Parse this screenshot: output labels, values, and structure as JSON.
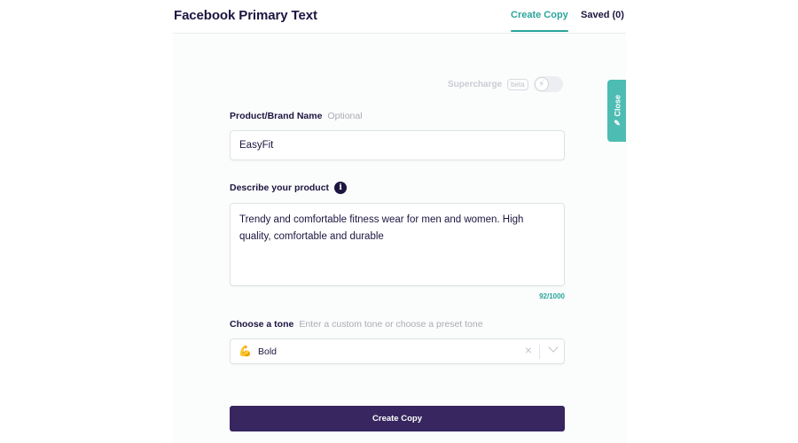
{
  "header": {
    "title": "Facebook Primary Text",
    "tabs": [
      {
        "label": "Create Copy",
        "active": true
      },
      {
        "label": "Saved (0)",
        "active": false
      }
    ]
  },
  "supercharge": {
    "label": "Supercharge",
    "badge": "beta",
    "toggle_on": false,
    "icon": "lightning-icon"
  },
  "close_tab": {
    "label": "Close",
    "icon": "pencil-icon"
  },
  "form": {
    "product_name": {
      "label": "Product/Brand Name",
      "hint": "Optional",
      "value": "EasyFit"
    },
    "description": {
      "label": "Describe your product",
      "info_icon": "i",
      "value": "Trendy and comfortable fitness wear for men and women. High quality, comfortable and durable",
      "char_count": "92/1000"
    },
    "tone": {
      "label": "Choose a tone",
      "hint": "Enter a custom tone or choose a preset tone",
      "selected_emoji": "💪",
      "selected": "Bold",
      "clear_icon": "×"
    },
    "submit_label": "Create Copy"
  },
  "colors": {
    "accent": "#2aa59b",
    "primary": "#37265f",
    "text": "#1c1540",
    "close_tab": "#4dbcb2"
  }
}
